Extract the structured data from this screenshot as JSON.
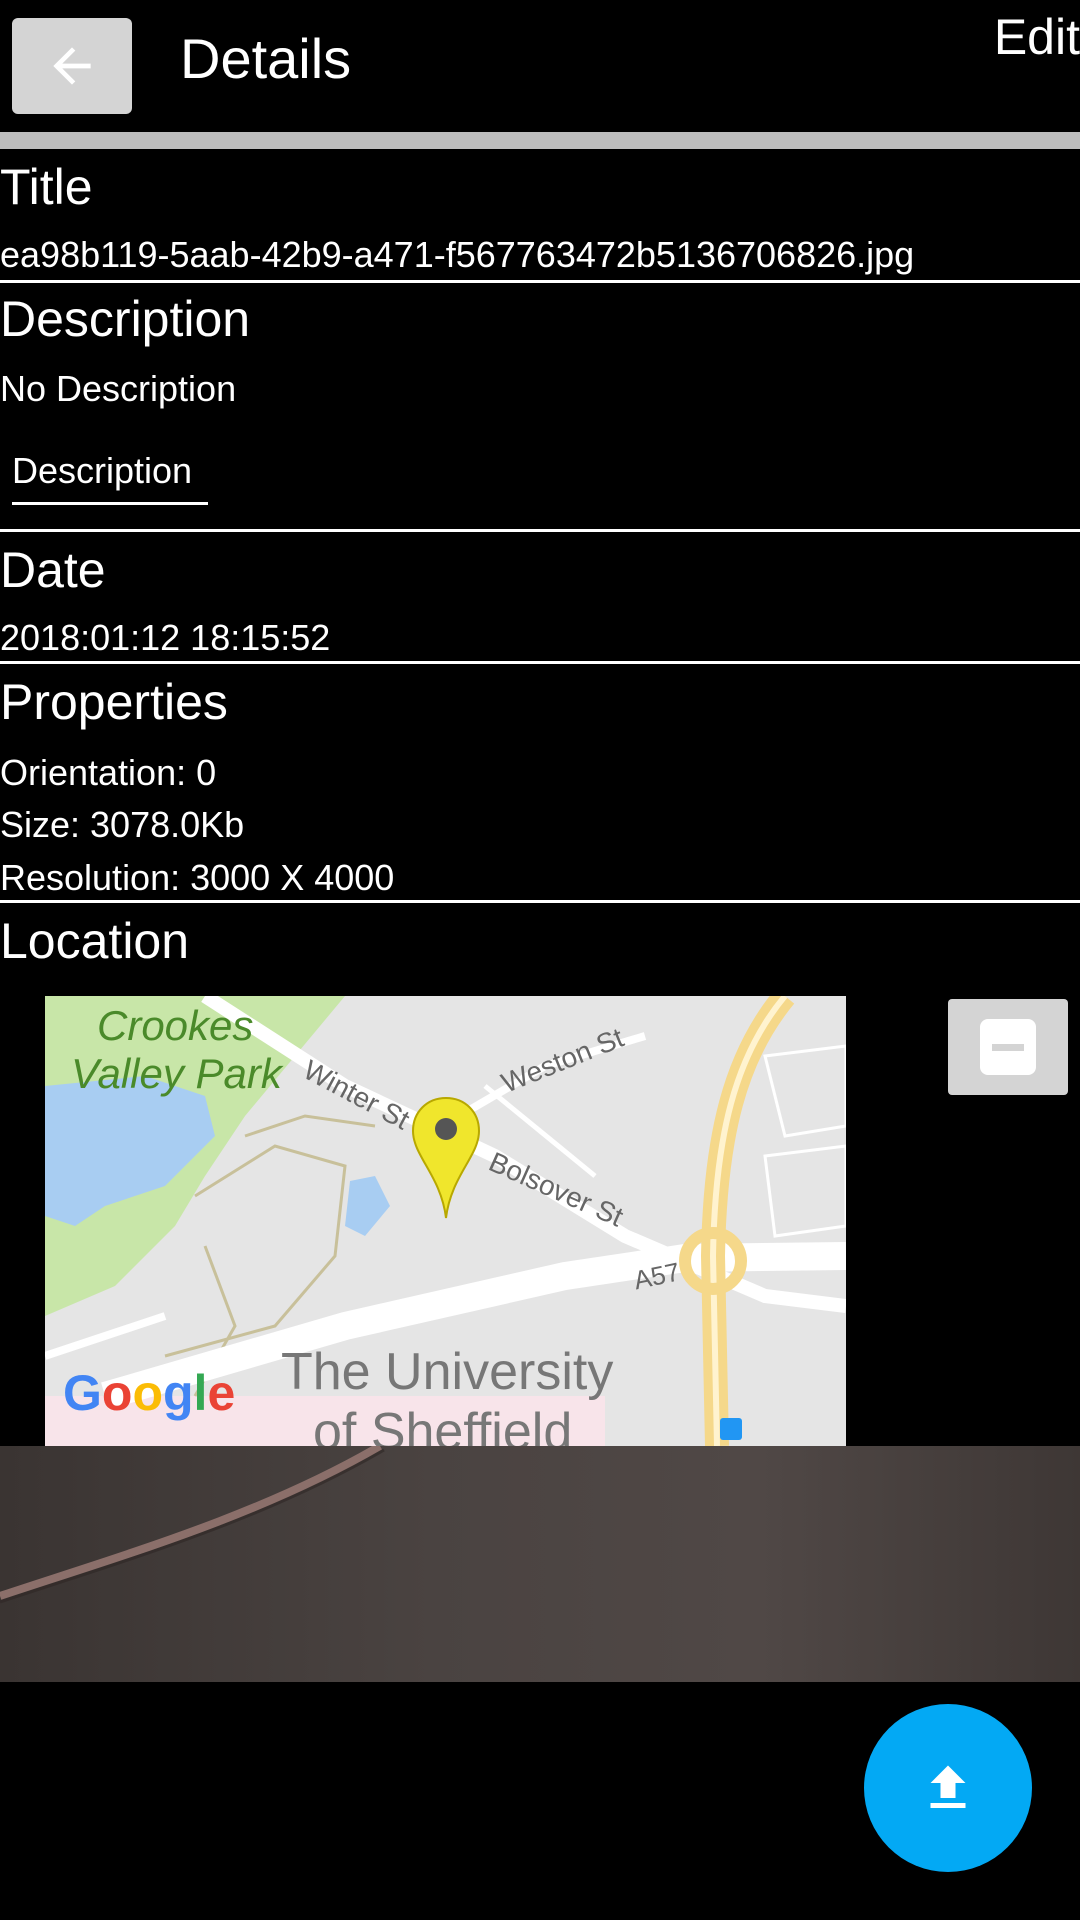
{
  "header": {
    "title": "Details",
    "edit_label": "Edit"
  },
  "icons": {
    "back": "back-arrow-icon",
    "zoom": "minus-icon",
    "upload": "upload-icon",
    "pin": "map-pin-icon"
  },
  "sections": {
    "title": {
      "label": "Title",
      "value": "ea98b119-5aab-42b9-a471-f567763472b5136706826.jpg"
    },
    "description": {
      "label": "Description",
      "value": "No Description",
      "input_hint": "Description"
    },
    "date": {
      "label": "Date",
      "value": "2018:01:12 18:15:52"
    },
    "properties": {
      "label": "Properties",
      "orientation": "Orientation: 0",
      "size": "Size: 3078.0Kb",
      "resolution": "Resolution: 3000 X  4000"
    },
    "location": {
      "label": "Location"
    }
  },
  "map": {
    "labels": {
      "park1": "Crookes",
      "park2": "Valley Park",
      "winter": "Winter St",
      "weston": "Weston St",
      "bolsover": "Bolsover St",
      "a57": "A57",
      "uni1": "The University",
      "uni2": "of Sheffield"
    },
    "google": [
      "G",
      "o",
      "o",
      "g",
      "l",
      "e"
    ],
    "google_colors": [
      "#4285F4",
      "#EA4335",
      "#FBBC05",
      "#4285F4",
      "#34A853",
      "#EA4335"
    ]
  },
  "colors": {
    "accent": "#03a9f4",
    "button_gray": "#d4d4d4",
    "pin": "#ffee33"
  }
}
